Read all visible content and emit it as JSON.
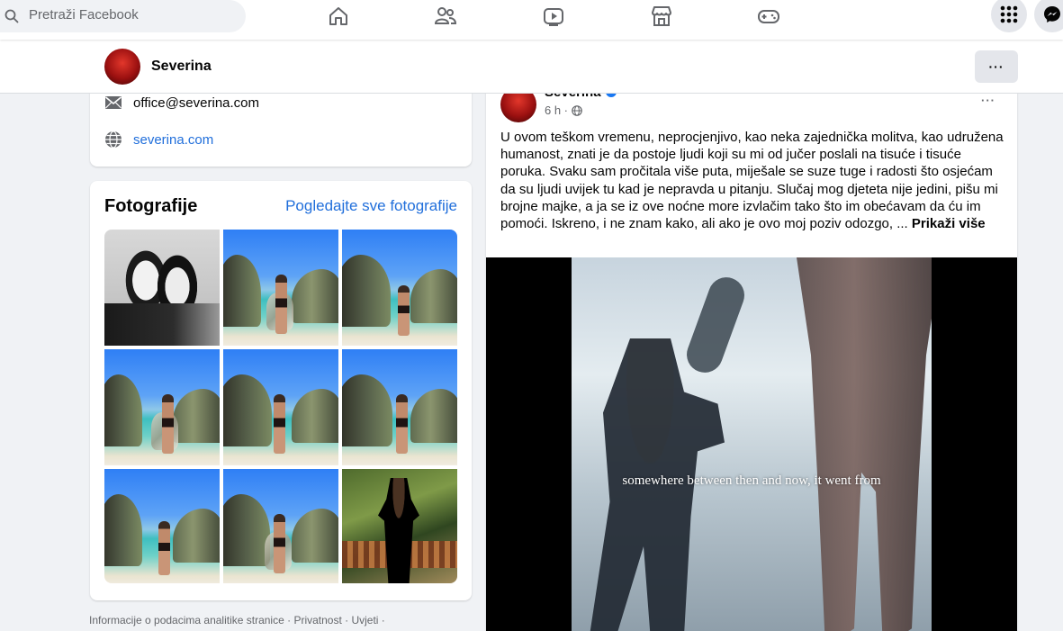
{
  "topbar": {
    "search_placeholder": "Pretraži Facebook",
    "nav_icons": [
      "home-icon",
      "friends-icon",
      "watch-icon",
      "marketplace-icon",
      "gaming-icon"
    ],
    "right_icons": [
      "menu-grid-icon",
      "messenger-icon"
    ]
  },
  "page": {
    "name": "Severina",
    "more_label": "···"
  },
  "intro": {
    "email": "office@severina.com",
    "website": "severina.com"
  },
  "photos": {
    "title": "Fotografije",
    "see_all_link": "Pogledajte sve fotografije"
  },
  "footer": {
    "links_text": "Informacije o podacima analitike stranice · Privatnost · Uvjeti ·"
  },
  "post": {
    "author": "Severina",
    "time": "6 h ·",
    "more_label": "···",
    "text": "U ovom teškom vremenu, neprocjenjivo, kao neka zajednička molitva, kao udružena humanost, znati je da postoje ljudi koji su mi od jučer poslali na tisuće i tisuće poruka. Svaku sam pročitala više puta, miješale se suze tuge i radosti što osjećam da su ljudi uvijek tu kad je nepravda u pitanju. Slučaj mog djeteta nije jedini, pišu mi brojne majke, a ja se iz ove noćne more izvlačim tako što im obećavam da ću im pomoći. Iskreno, i ne znam kako, ali ako je ovo moj poziv odozgo, ... ",
    "see_more": "Prikaži više",
    "video_subtitle": "somewhere between then and now, it went from"
  },
  "colors": {
    "link": "#216fdb",
    "background": "#f0f2f5",
    "verified": "#1877f2"
  }
}
